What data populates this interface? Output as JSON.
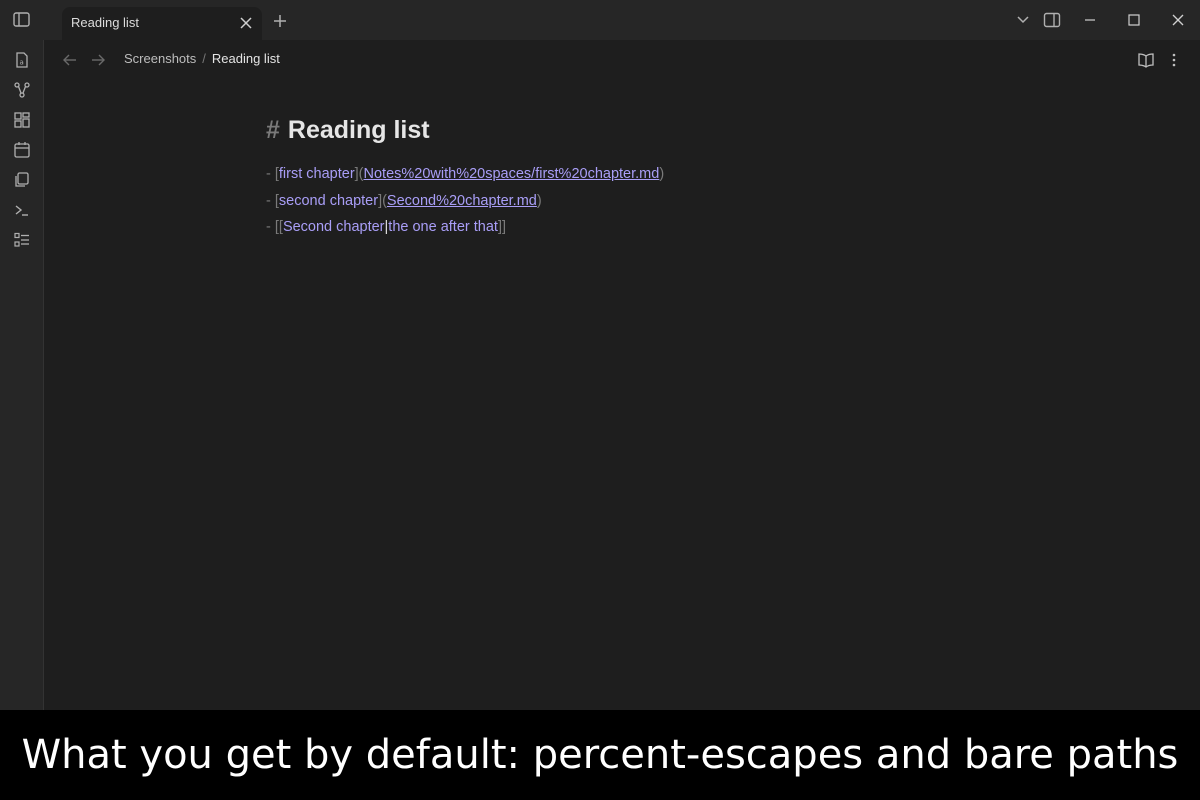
{
  "tab": {
    "title": "Reading list"
  },
  "breadcrumb": {
    "parent": "Screenshots",
    "separator": "/",
    "current": "Reading list"
  },
  "ribbon": {
    "icons": [
      "new-note-icon",
      "graph-icon",
      "canvas-icon",
      "calendar-icon",
      "templates-icon",
      "terminal-icon",
      "tasks-icon"
    ]
  },
  "editor": {
    "heading_marker": "#",
    "heading": "Reading list",
    "lines": [
      {
        "bullet": "-",
        "open": "[",
        "text": "first chapter",
        "mid": "](",
        "url": "Notes%20with%20spaces/first%20chapter.md",
        "close": ")"
      },
      {
        "bullet": "-",
        "open": "[",
        "text": "second chapter",
        "mid": "](",
        "url": "Second%20chapter.md",
        "close": ")"
      },
      {
        "bullet": "-",
        "open": "[[",
        "target": "Second chapter",
        "pipe": "|",
        "alias": "the one after that",
        "close": "]]"
      }
    ]
  },
  "caption": "What you get by default: percent-escapes and bare paths",
  "colors": {
    "accent": "#a99ef7",
    "background": "#1e1e1e",
    "chrome": "#262626"
  }
}
